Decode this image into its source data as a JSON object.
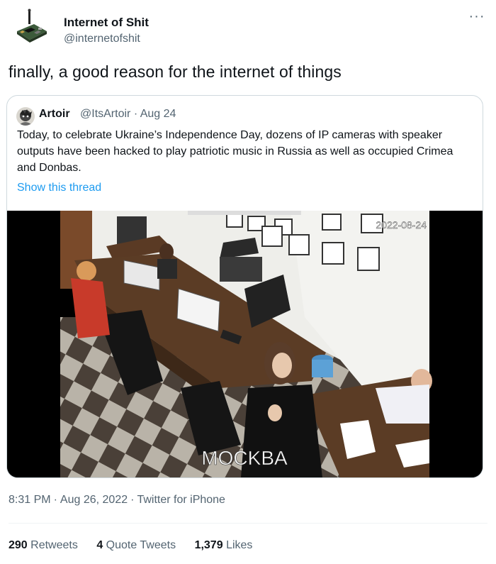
{
  "author": {
    "name": "Internet of Shit",
    "handle": "@internetofshit",
    "more_label": "···"
  },
  "tweet": {
    "text": "finally, a good reason for the internet of things"
  },
  "quote_tweet": {
    "name": "Artoir",
    "handle": "@ItsArtoir",
    "dot": "·",
    "date": "Aug 24",
    "text": "Today, to celebrate Ukraine’s Independence Day, dozens of IP cameras with speaker outputs have been hacked to play patriotic music in Russia as well as occupied Crimea and Donbas.",
    "show_thread": "Show this thread",
    "video": {
      "timestamp_overlay": "2022-08-24",
      "caption": "MOCKBA"
    }
  },
  "meta": {
    "time": "8:31 PM",
    "date": "Aug 26, 2022",
    "source": "Twitter for iPhone",
    "sep": "·"
  },
  "stats": {
    "retweets_count": "290",
    "retweets_label": "Retweets",
    "quotes_count": "4",
    "quotes_label": "Quote Tweets",
    "likes_count": "1,379",
    "likes_label": "Likes"
  },
  "colors": {
    "accent": "#1d9bf0",
    "text": "#0f1419",
    "secondary": "#536471",
    "border": "#cfd9de"
  }
}
